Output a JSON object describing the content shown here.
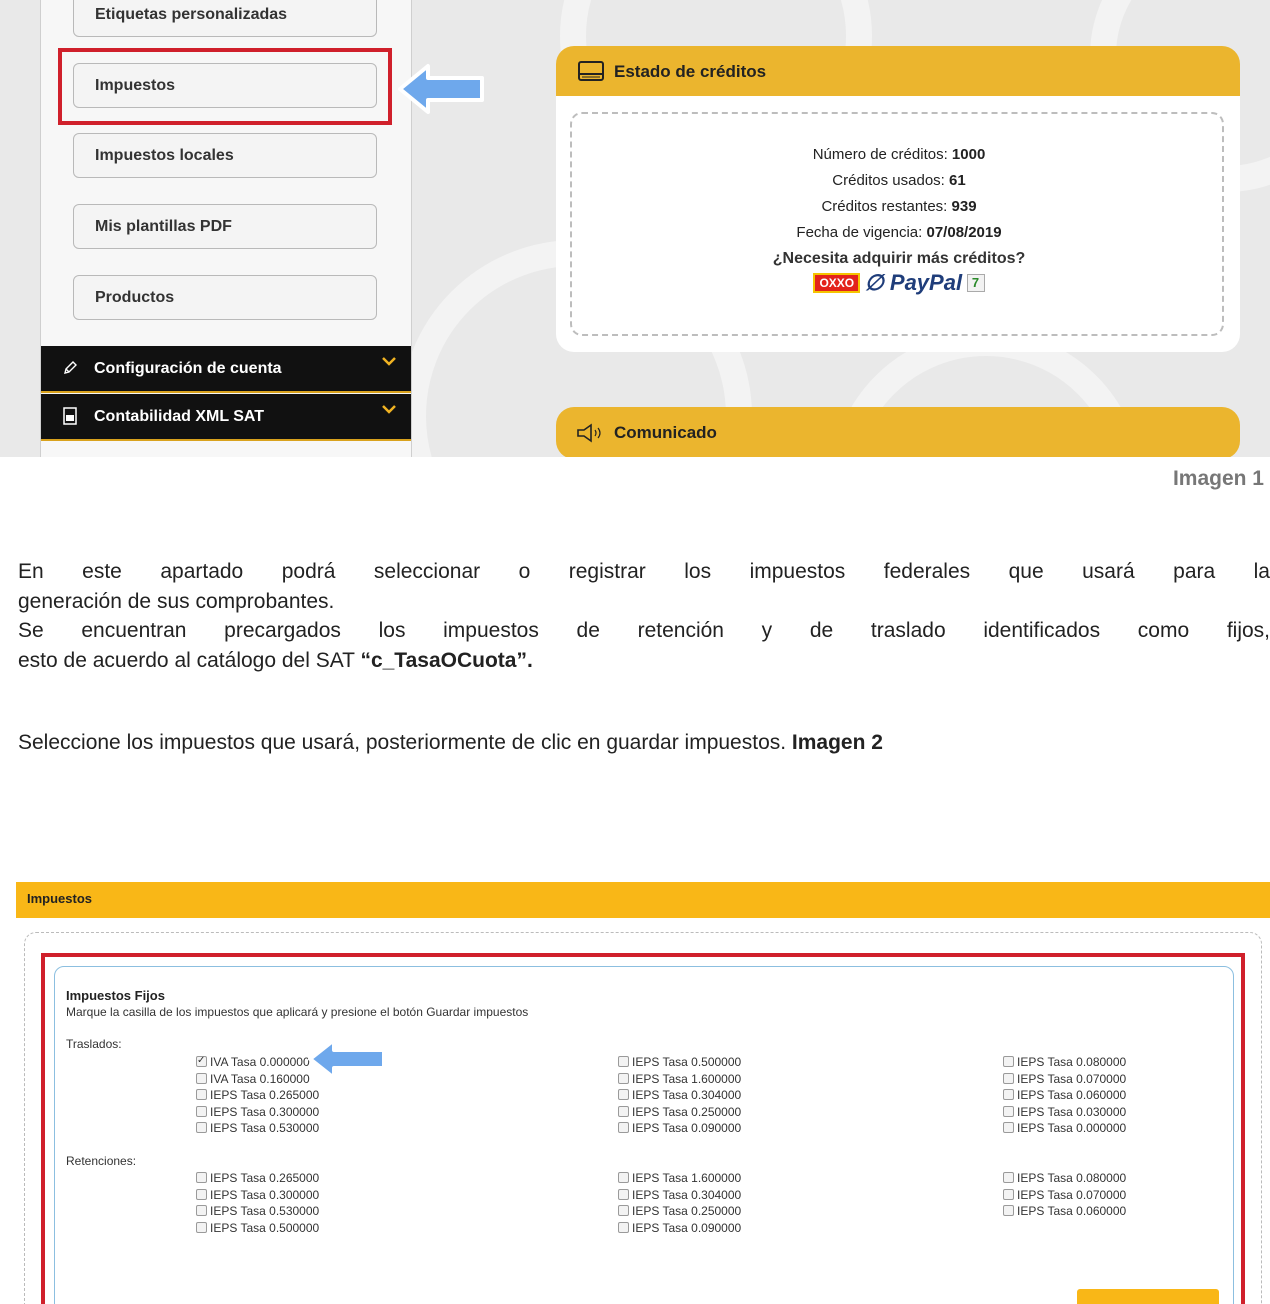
{
  "sidebar": {
    "items": [
      {
        "label": "Etiquetas personalizadas"
      },
      {
        "label": "Impuestos"
      },
      {
        "label": "Impuestos locales"
      },
      {
        "label": "Mis plantillas PDF"
      },
      {
        "label": "Productos"
      }
    ],
    "sections": [
      {
        "label": "Configuración de cuenta",
        "icon": "pencil-icon"
      },
      {
        "label": "Contabilidad XML SAT",
        "icon": "document-icon"
      }
    ]
  },
  "credits": {
    "title": "Estado de créditos",
    "rows": [
      {
        "label": "Número de créditos:",
        "value": "1000"
      },
      {
        "label": "Créditos usados:",
        "value": "61"
      },
      {
        "label": "Créditos restantes:",
        "value": "939"
      },
      {
        "label": "Fecha de vigencia:",
        "value": "07/08/2019"
      }
    ],
    "buy_question": "¿Necesita adquirir más créditos?",
    "payment_logos": {
      "oxxo": "OXXO",
      "paypal": "PayPal",
      "seven": "7"
    }
  },
  "comunicado": {
    "title": "Comunicado"
  },
  "image1_label": "Imagen 1",
  "body_text": {
    "p1_line1": "En este apartado podrá seleccionar o registrar los impuestos federales que usará para la",
    "p1_line2": "generación de sus comprobantes.",
    "p2_line1": "Se encuentran precargados los impuestos de retención y de traslado identificados como fijos,",
    "p2_line2_pre": "esto de acuerdo al catálogo del SAT ",
    "p2_line2_bold": "“c_TasaOCuota”.",
    "p3_pre": "Seleccione los impuestos que usará, posteriormente de clic en guardar impuestos. ",
    "p3_bold": "Imagen 2"
  },
  "impuestos": {
    "header": "Impuestos",
    "section_title": "Impuestos Fijos",
    "description": "Marque la casilla de los impuestos que aplicará y presione el botón Guardar impuestos",
    "traslados_label": "Traslados:",
    "retenciones_label": "Retenciones:",
    "traslados": [
      [
        {
          "label": "IVA Tasa 0.000000",
          "checked": true
        },
        {
          "label": "IVA Tasa 0.160000",
          "checked": false
        },
        {
          "label": "IEPS Tasa 0.265000",
          "checked": false
        },
        {
          "label": "IEPS Tasa 0.300000",
          "checked": false
        },
        {
          "label": "IEPS Tasa 0.530000",
          "checked": false
        }
      ],
      [
        {
          "label": "IEPS Tasa 0.500000",
          "checked": false
        },
        {
          "label": "IEPS Tasa 1.600000",
          "checked": false
        },
        {
          "label": "IEPS Tasa 0.304000",
          "checked": false
        },
        {
          "label": "IEPS Tasa 0.250000",
          "checked": false
        },
        {
          "label": "IEPS Tasa 0.090000",
          "checked": false
        }
      ],
      [
        {
          "label": "IEPS Tasa 0.080000",
          "checked": false
        },
        {
          "label": "IEPS Tasa 0.070000",
          "checked": false
        },
        {
          "label": "IEPS Tasa 0.060000",
          "checked": false
        },
        {
          "label": "IEPS Tasa 0.030000",
          "checked": false
        },
        {
          "label": "IEPS Tasa 0.000000",
          "checked": false
        }
      ]
    ],
    "retenciones": [
      [
        {
          "label": "IEPS Tasa 0.265000",
          "checked": false
        },
        {
          "label": "IEPS Tasa 0.300000",
          "checked": false
        },
        {
          "label": "IEPS Tasa 0.530000",
          "checked": false
        },
        {
          "label": "IEPS Tasa 0.500000",
          "checked": false
        }
      ],
      [
        {
          "label": "IEPS Tasa 1.600000",
          "checked": false
        },
        {
          "label": "IEPS Tasa 0.304000",
          "checked": false
        },
        {
          "label": "IEPS Tasa 0.250000",
          "checked": false
        },
        {
          "label": "IEPS Tasa 0.090000",
          "checked": false
        }
      ],
      [
        {
          "label": "IEPS Tasa 0.080000",
          "checked": false
        },
        {
          "label": "IEPS Tasa 0.070000",
          "checked": false
        },
        {
          "label": "IEPS Tasa 0.060000",
          "checked": false
        }
      ]
    ]
  },
  "colors": {
    "accent": "#ebb52e",
    "highlight": "#d0202b",
    "arrow": "#6ea8ec"
  }
}
